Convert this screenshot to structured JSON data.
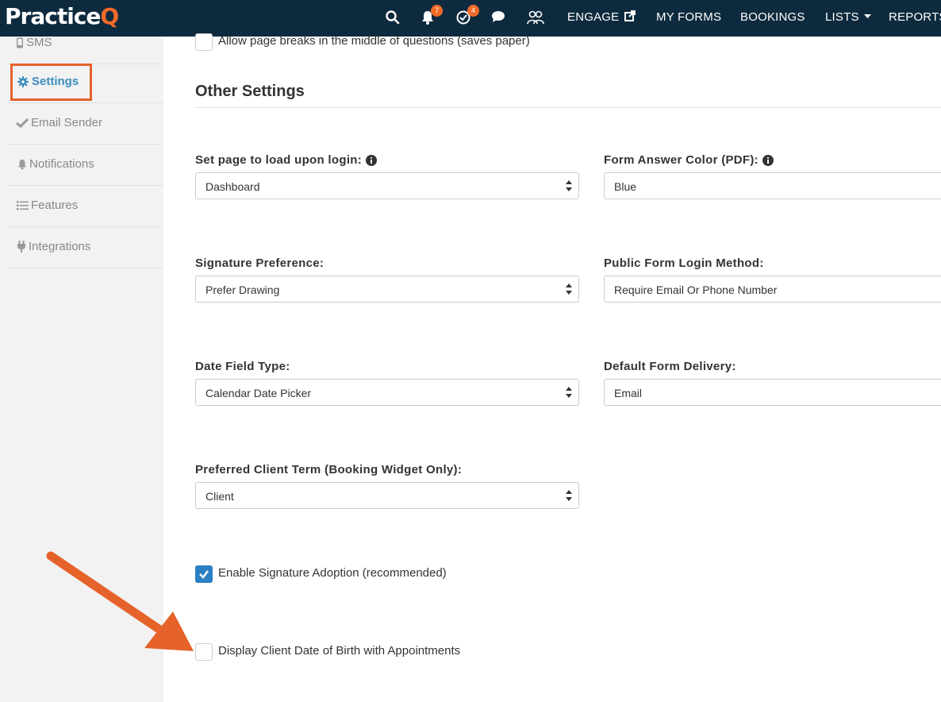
{
  "brand": {
    "name_main": "Practice",
    "name_accent": "Q",
    "accent_color": "#f26a28",
    "nav_bg": "#0e2a3e"
  },
  "topnav": {
    "icons": [
      {
        "name": "search-icon"
      },
      {
        "name": "bell-icon",
        "badge": "7"
      },
      {
        "name": "check-circle-icon",
        "badge": "4"
      },
      {
        "name": "chat-icon"
      },
      {
        "name": "users-icon"
      }
    ],
    "links": {
      "engage": "ENGAGE",
      "my_forms": "MY FORMS",
      "bookings": "BOOKINGS",
      "lists": "LISTS",
      "reports": "REPORTS"
    }
  },
  "sidebar": {
    "items": [
      {
        "label": "SMS",
        "icon": "phone-icon"
      },
      {
        "label": "Settings",
        "icon": "gear-icon",
        "active": true
      },
      {
        "label": "Email Sender",
        "icon": "check-icon"
      },
      {
        "label": "Notifications",
        "icon": "bell-icon"
      },
      {
        "label": "Features",
        "icon": "list-icon"
      },
      {
        "label": "Integrations",
        "icon": "plug-icon"
      }
    ]
  },
  "main": {
    "top_checkbox": {
      "label": "Allow page breaks in the middle of questions (saves paper)",
      "checked": false
    },
    "section_title": "Other Settings",
    "fields": {
      "login_page": {
        "label": "Set page to load upon login:",
        "value": "Dashboard"
      },
      "answer_color": {
        "label": "Form Answer Color (PDF):",
        "value": "Blue"
      },
      "signature_pref": {
        "label": "Signature Preference:",
        "value": "Prefer Drawing"
      },
      "public_login": {
        "label": "Public Form Login Method:",
        "value": "Require Email Or Phone Number"
      },
      "date_field": {
        "label": "Date Field Type:",
        "value": "Calendar Date Picker"
      },
      "form_delivery": {
        "label": "Default Form Delivery:",
        "value": "Email"
      },
      "client_term": {
        "label": "Preferred Client Term (Booking Widget Only):",
        "value": "Client"
      }
    },
    "signature_adoption": {
      "label": "Enable Signature Adoption (recommended)",
      "checked": true
    },
    "display_dob": {
      "label": "Display Client Date of Birth with Appointments",
      "checked": false
    }
  },
  "annotation": {
    "highlight_color": "#e5622a"
  }
}
